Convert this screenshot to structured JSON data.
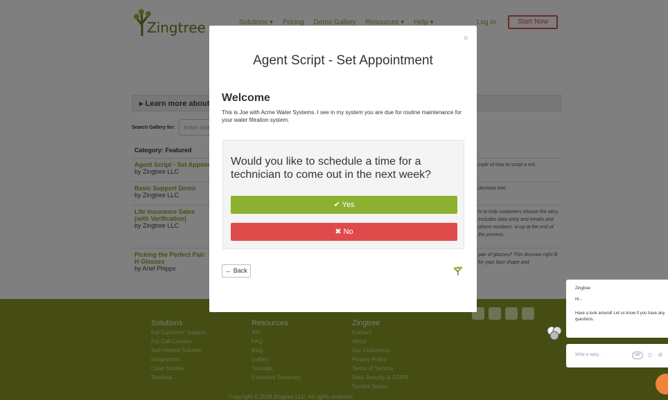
{
  "header": {
    "logo_text": "Zingtree",
    "nav": [
      "Solutions ▾",
      "Pricing",
      "Demo Gallery",
      "Resources ▾",
      "Help ▾"
    ],
    "login": "Log In",
    "start_now": "Start Now"
  },
  "gallery": {
    "learn_more": "▸ Learn more about th",
    "search_label": "Search Gallery for:",
    "search_placeholder": "enter sea",
    "category": "Category: Featured",
    "items": [
      {
        "title": "Agent Script - Set Appoint",
        "by": "by Zingtree LLC",
        "desc": "mple of how to script a ent."
      },
      {
        "title": "Basic Support Demo",
        "by": "by Zingtree LLC",
        "desc": "decision tree."
      },
      {
        "title": "Life Insurance Sales (with Verification)",
        "by": "by Zingtree LLC",
        "desc": "ts to help customers choose the olicy. Includes data entry and emails and phone numbers. w-up at the end of the process."
      },
      {
        "title": "Picking the Perfect Pair: H Glasses",
        "by": "by Ariel Phipps",
        "desc": "pair of glasses? This decision right fit for your face shape and"
      }
    ]
  },
  "footer": {
    "solutions": {
      "head": "Solutions",
      "links": [
        "For Customer Support",
        "For Call Centers",
        "Self-Hosted Solution",
        "Integrations",
        "Case Studies",
        "Zendesk"
      ]
    },
    "resources": {
      "head": "Resources",
      "links": [
        "API",
        "FAQ",
        "Blog",
        "Gallery",
        "Tutorials",
        "Executive Summary"
      ]
    },
    "zingtree": {
      "head": "Zingtree",
      "links": [
        "Contact",
        "About",
        "Our Customers",
        "Privacy Policy",
        "Terms of Service",
        "Data Security & GDPR",
        "System Status"
      ]
    },
    "copyright": "Copyright © 2018 Zingtree LLC. All rights reserved."
  },
  "modal": {
    "close": "×",
    "title": "Agent Script - Set Appointment",
    "heading": "Welcome",
    "intro": "This is Joe with Acme Water Systems. I see in my system you are due for routine maintenance for your water filtration system.",
    "question": "Would you like to schedule a time for a technician to come out in the next week?",
    "yes": "✔ Yes",
    "no": "✖ No",
    "back": "← Back"
  },
  "chat": {
    "name": "Zingtree",
    "greeting": "Hi -",
    "message": "Have a look around! Let us know if you have any questions.",
    "input_placeholder": "Write a reply...",
    "gif": "GIF"
  },
  "colors": {
    "brand_green": "#8aa02a",
    "yes_green": "#8cb030",
    "no_red": "#df4b4b",
    "footer_green": "#8a9a26",
    "chat_orange": "#f0843a"
  }
}
